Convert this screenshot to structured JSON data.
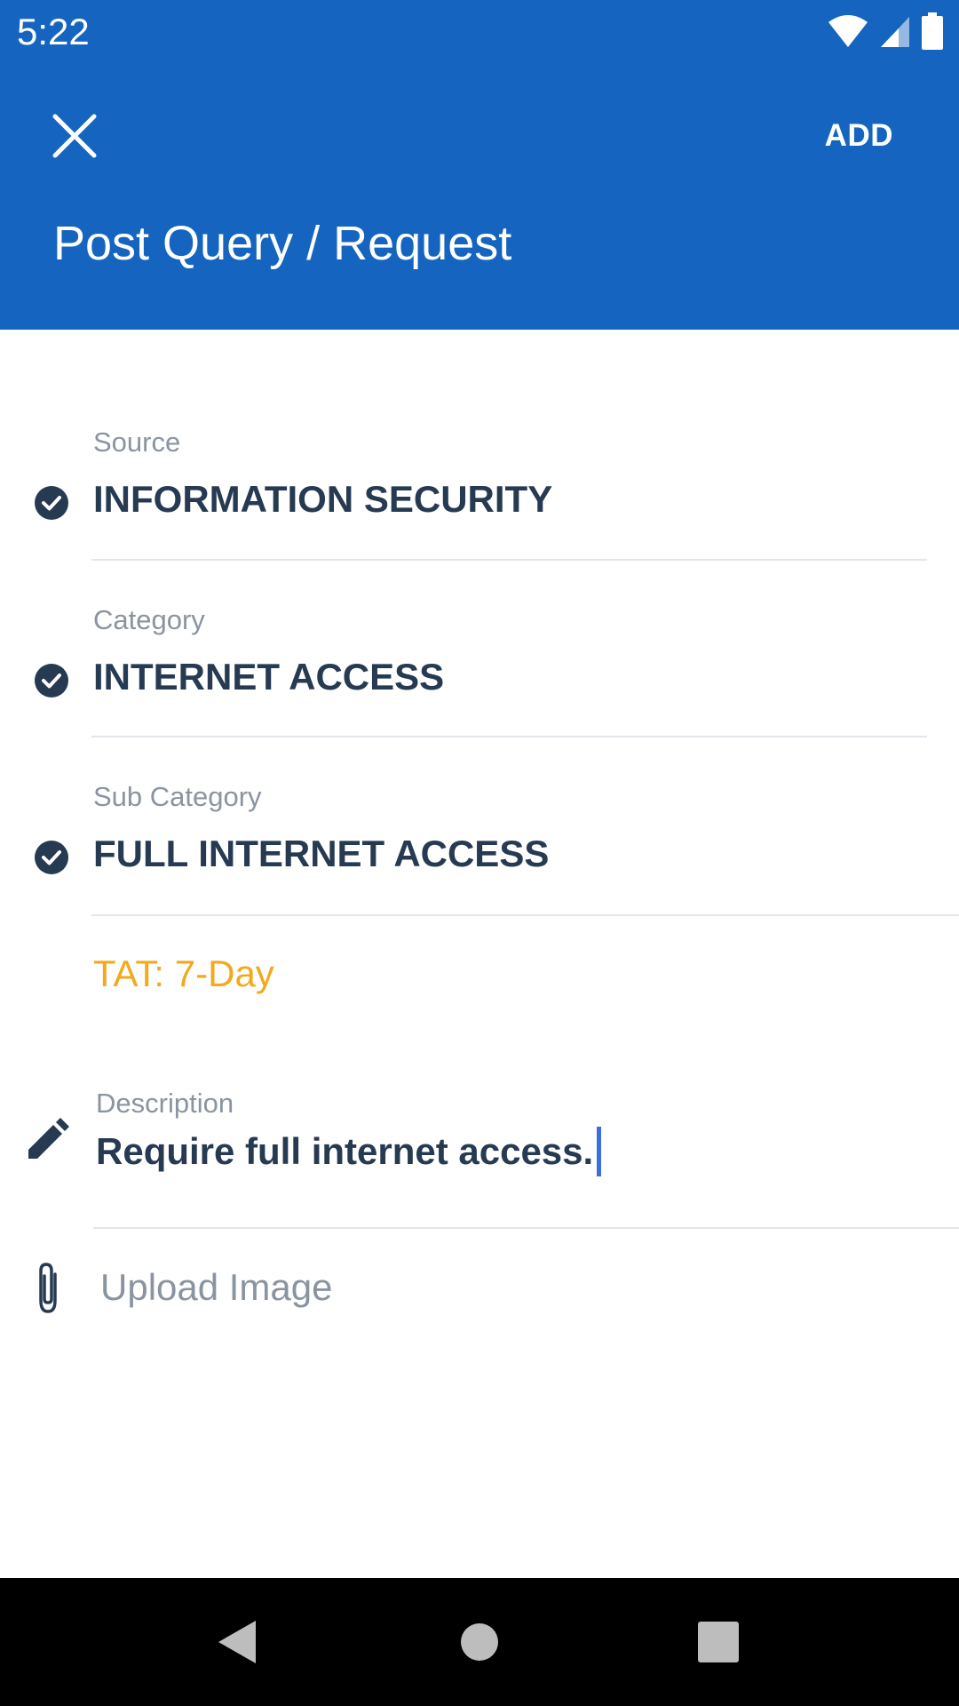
{
  "status_bar": {
    "time": "5:22",
    "icons": [
      "wifi-icon",
      "cellular-signal-icon",
      "battery-icon"
    ]
  },
  "app_bar": {
    "close_icon": "close-icon",
    "action_label": "ADD",
    "title": "Post Query / Request"
  },
  "fields": [
    {
      "label": "Source",
      "value": "INFORMATION SECURITY",
      "icon": "check-circle-icon"
    },
    {
      "label": "Category",
      "value": "INTERNET ACCESS",
      "icon": "check-circle-icon"
    },
    {
      "label": "Sub Category",
      "value": "FULL INTERNET ACCESS",
      "icon": "check-circle-icon"
    }
  ],
  "tat": "TAT: 7-Day",
  "description": {
    "label": "Description",
    "value": "Require full internet access.",
    "icon": "pencil-icon"
  },
  "upload": {
    "label": "Upload Image",
    "icon": "paperclip-icon"
  },
  "nav_bar": {
    "icons": [
      "back-icon",
      "home-icon",
      "recents-icon"
    ]
  },
  "colors": {
    "primary": "#1565c0",
    "text_dark": "#263a52",
    "label_gray": "#8a94a0",
    "tat_orange": "#f2a91b",
    "caret": "#3b6fe0"
  }
}
